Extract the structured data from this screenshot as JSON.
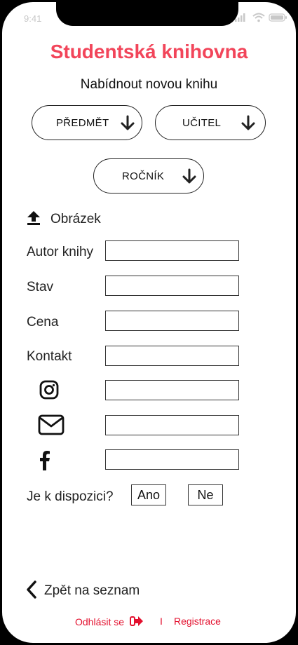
{
  "status_bar": {
    "time": "9:41",
    "icons": [
      "signal-icon",
      "wifi-icon",
      "battery-icon"
    ]
  },
  "header": {
    "title": "Studentská knihovna",
    "subtitle": "Nabídnout novou knihu"
  },
  "filters": [
    {
      "label": "PŘEDMĚT",
      "icon": "arrow-down-icon"
    },
    {
      "label": "UČITEL",
      "icon": "arrow-down-icon"
    },
    {
      "label": "ROČNÍK",
      "icon": "arrow-down-icon"
    }
  ],
  "upload": {
    "label": "Obrázek",
    "icon": "upload-icon"
  },
  "form": {
    "author_label": "Autor knihy",
    "author_value": "",
    "condition_label": "Stav",
    "condition_value": "",
    "price_label": "Cena",
    "price_value": "",
    "contact_label": "Kontakt",
    "contact_value": "",
    "instagram_value": "",
    "email_value": "",
    "facebook_value": ""
  },
  "availability": {
    "question": "Je k dispozici?",
    "yes": "Ano",
    "no": "Ne"
  },
  "navigation": {
    "back": "Zpět na seznam"
  },
  "footer": {
    "logout": "Odhlásit se",
    "separator": "I",
    "register": "Registrace"
  },
  "colors": {
    "accent": "#f2455a",
    "link": "#e3102e",
    "text": "#222222"
  }
}
